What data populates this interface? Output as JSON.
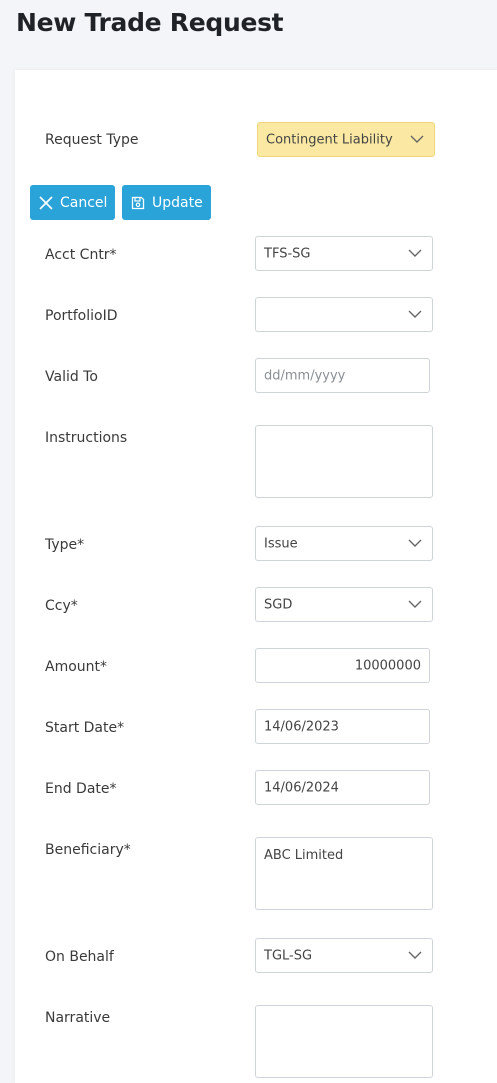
{
  "page": {
    "title": "New Trade Request"
  },
  "toolbar": {
    "cancel_label": "Cancel",
    "update_label": "Update"
  },
  "form": {
    "request_type": {
      "label": "Request Type",
      "value": "Contingent Liability"
    },
    "acct_cntr": {
      "label": "Acct Cntr*",
      "value": "TFS-SG"
    },
    "portfolio_id": {
      "label": "PortfolioID",
      "value": ""
    },
    "valid_to": {
      "label": "Valid To",
      "placeholder": "dd/mm/yyyy"
    },
    "instructions": {
      "label": "Instructions",
      "value": ""
    },
    "type": {
      "label": "Type*",
      "value": "Issue"
    },
    "ccy": {
      "label": "Ccy*",
      "value": "SGD"
    },
    "amount": {
      "label": "Amount*",
      "value": "10000000"
    },
    "start_date": {
      "label": "Start Date*",
      "value": "14/06/2023"
    },
    "end_date": {
      "label": "End Date*",
      "value": "14/06/2024"
    },
    "beneficiary": {
      "label": "Beneficiary*",
      "value": "ABC Limited"
    },
    "on_behalf": {
      "label": "On Behalf",
      "value": "TGL-SG"
    },
    "narrative": {
      "label": "Narrative",
      "value": ""
    }
  },
  "icons": {
    "cancel": "close-icon",
    "update": "save-icon",
    "dropdown": "chevron-down-icon"
  },
  "colors": {
    "accent": "#2aa3d8",
    "highlight_select": "#fbe9a3"
  }
}
